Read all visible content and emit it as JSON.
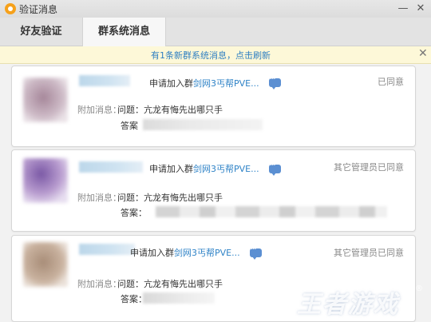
{
  "window": {
    "title": "验证消息",
    "minimize": "—",
    "close": "✕"
  },
  "tabs": [
    {
      "label": "好友验证"
    },
    {
      "label": "群系统消息"
    }
  ],
  "notice": {
    "text": "有1条新群系统消息，点击刷新",
    "close": "✕"
  },
  "requests": [
    {
      "action": "申请加入群",
      "group": "剑网3丐帮PVE...",
      "status": "已同意",
      "extra_label": "附加消息：",
      "question_label": "问题：",
      "question": "亢龙有悔先出哪只手",
      "answer_label": "答案"
    },
    {
      "action": "申请加入群",
      "group": "剑网3丐帮PVE...",
      "status": "其它管理员已同意",
      "extra_label": "附加消息：",
      "question_label": "问题：",
      "question": "亢龙有悔先出哪只手",
      "answer_label": "答案："
    },
    {
      "action": "申请加入群",
      "group": "剑网3丐帮PVE...",
      "status": "其它管理员已同意",
      "extra_label": "附加消息：",
      "question_label": "问题：",
      "question": "亢龙有悔先出哪只手",
      "answer_label": "答案："
    }
  ],
  "icons": {
    "app": "app-logo-icon",
    "more": "chat-bubble-more-icon"
  },
  "colors": {
    "link": "#2f83c7",
    "notice_bg": "#fdf8d8",
    "notice_text": "#2f7fc2"
  },
  "watermark": {
    "text": "王者游戏",
    "reg": "®"
  }
}
